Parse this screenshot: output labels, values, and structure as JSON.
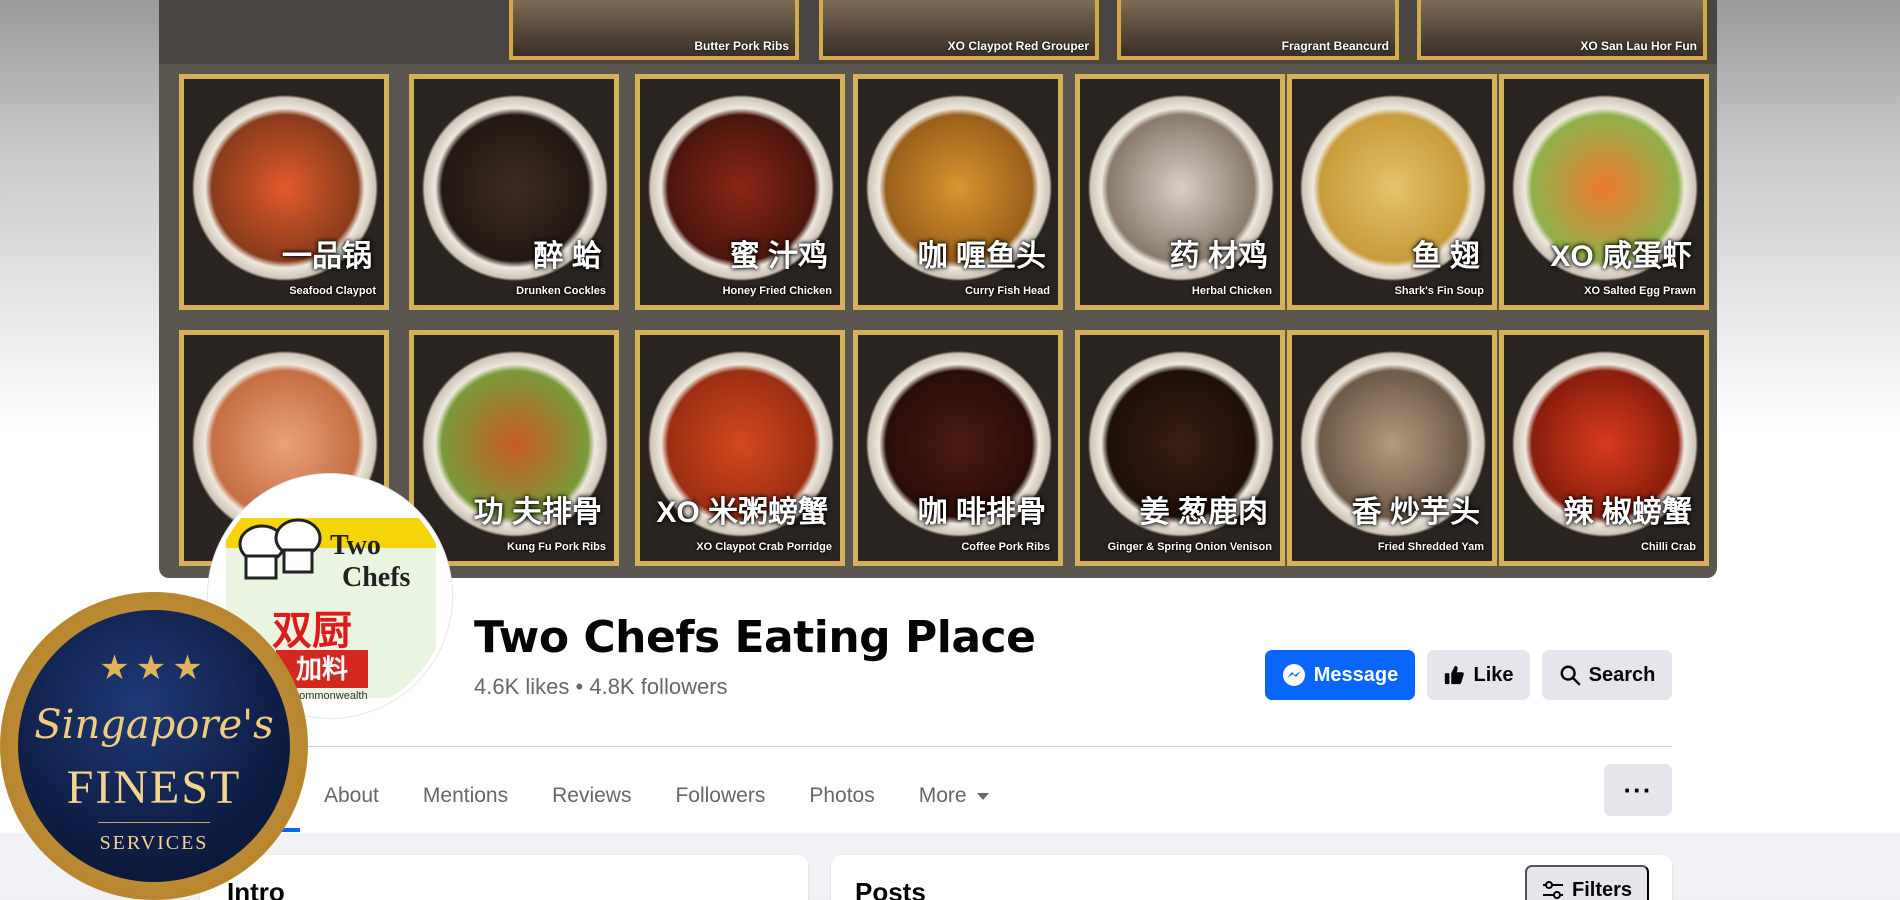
{
  "page": {
    "name": "Two Chefs Eating Place",
    "likes": "4.6K likes",
    "separator": "•",
    "followers": "4.8K followers"
  },
  "cover": {
    "strip_items": [
      {
        "en": "Butter Pork Ribs"
      },
      {
        "en": "XO Claypot Red Grouper"
      },
      {
        "en": "Fragrant Beancurd"
      },
      {
        "en": "XO San Lau Hor Fun"
      }
    ],
    "dishes": [
      {
        "zh": "一品锅",
        "en": "Seafood Claypot",
        "c1": "#e05a2b",
        "c2": "#8a3b1c"
      },
      {
        "zh": "醉 蛤",
        "en": "Drunken Cockles",
        "c1": "#3d2a20",
        "c2": "#231812"
      },
      {
        "zh": "蜜 汁鸡",
        "en": "Honey Fried Chicken",
        "c1": "#8b2716",
        "c2": "#4a150c"
      },
      {
        "zh": "咖 喱鱼头",
        "en": "Curry Fish Head",
        "c1": "#d9962e",
        "c2": "#9a5f1a"
      },
      {
        "zh": "药 材鸡",
        "en": "Herbal Chicken",
        "c1": "#d9cfc6",
        "c2": "#8a7b6c"
      },
      {
        "zh": "鱼 翅",
        "en": "Shark's Fin Soup",
        "c1": "#e3c36a",
        "c2": "#c79c3c"
      },
      {
        "zh": "XO 咸蛋虾",
        "en": "XO Salted Egg Prawn",
        "c1": "#f07a2c",
        "c2": "#8fb04a"
      },
      {
        "zh": "",
        "en": "",
        "c1": "#e9a27a",
        "c2": "#c66f44"
      },
      {
        "zh": "功 夫排骨",
        "en": "Kung Fu Pork Ribs",
        "c1": "#c85a22",
        "c2": "#7a9a3a"
      },
      {
        "zh": "XO 米粥螃蟹",
        "en": "XO Claypot Crab Porridge",
        "c1": "#d24a1e",
        "c2": "#9b2e12"
      },
      {
        "zh": "咖 啡排骨",
        "en": "Coffee Pork Ribs",
        "c1": "#4a1a12",
        "c2": "#2a0d08"
      },
      {
        "zh": "姜 葱鹿肉",
        "en": "Ginger & Spring Onion Venison",
        "c1": "#3a1e12",
        "c2": "#1e0f08"
      },
      {
        "zh": "香 炒芋头",
        "en": "Fried Shredded Yam",
        "c1": "#b59a80",
        "c2": "#6f5a48"
      },
      {
        "zh": "辣 椒螃蟹",
        "en": "Chilli Crab",
        "c1": "#d63b1e",
        "c2": "#8a1e0c"
      }
    ]
  },
  "logo": {
    "line1": "Two",
    "line2": "Chefs",
    "zh": "双厨",
    "bottom_zh": "加料",
    "sub": "6 Commonwealth"
  },
  "actions": {
    "message": "Message",
    "like": "Like",
    "search": "Search",
    "more_dots": "···"
  },
  "tabs": [
    "About",
    "Mentions",
    "Reviews",
    "Followers",
    "Photos"
  ],
  "more_tab": "More",
  "intro_title": "Intro",
  "posts_title": "Posts",
  "filters": "Filters",
  "badge": {
    "stars": "★★★",
    "script": "Singapore's",
    "finest": "FINEST",
    "services": "SERVICES"
  },
  "colors": {
    "primary": "#0866ff",
    "button_gray": "#e4e6eb",
    "gold": "#d7b05a"
  }
}
